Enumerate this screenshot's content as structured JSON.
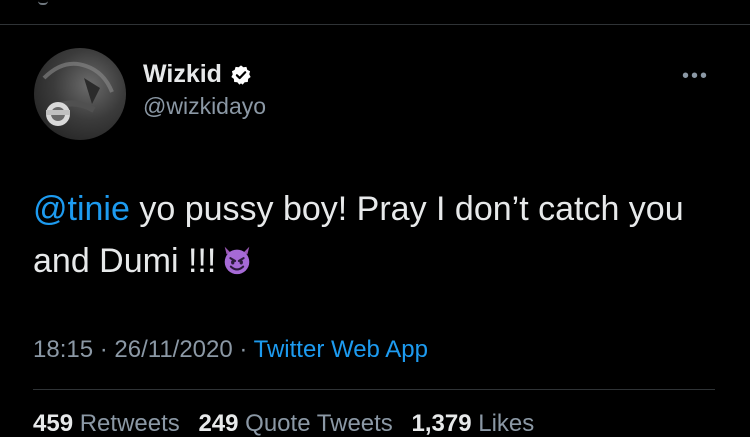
{
  "tweet": {
    "author": {
      "name": "Wizkid",
      "handle": "@wizkidayo",
      "verified": true
    },
    "text": {
      "mention": "@tinie",
      "line_rest": " yo pussy boy! Pray I don’t catch you and Dumi !!!",
      "emoji": "smiling-face-with-horns"
    },
    "meta": {
      "time": "18:15",
      "separator1": " · ",
      "date": "26/11/2020",
      "separator2": " · ",
      "app": "Twitter Web App"
    },
    "stats": {
      "retweets_count": "459",
      "retweets_label": "Retweets",
      "quote_count": "249",
      "quote_label": "Quote Tweets",
      "likes_count": "1,379",
      "likes_label": "Likes"
    }
  },
  "colors": {
    "background": "#000000",
    "text": "#e7e9ea",
    "secondary": "#8b98a5",
    "link": "#1d9bf0",
    "divider": "#2f3336"
  }
}
